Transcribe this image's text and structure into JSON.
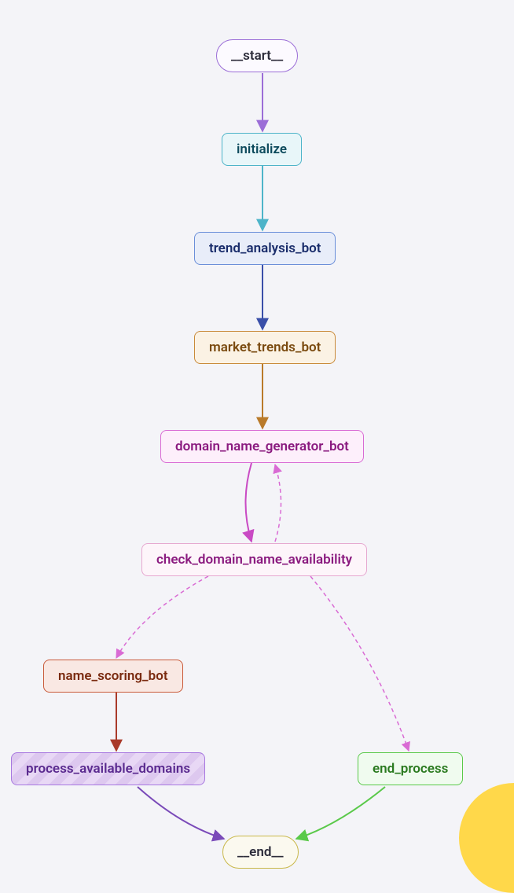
{
  "nodes": {
    "start": {
      "label": "__start__"
    },
    "initialize": {
      "label": "initialize"
    },
    "trend_analysis": {
      "label": "trend_analysis_bot"
    },
    "market_trends": {
      "label": "market_trends_bot"
    },
    "domain_gen": {
      "label": "domain_name_generator_bot"
    },
    "check_avail": {
      "label": "check_domain_name_availability"
    },
    "scoring": {
      "label": "name_scoring_bot"
    },
    "process_avail": {
      "label": "process_available_domains"
    },
    "end_process": {
      "label": "end_process"
    },
    "end": {
      "label": "__end__"
    }
  },
  "edges": [
    {
      "from": "start",
      "to": "initialize",
      "style": "solid",
      "color": "#9b6dd7"
    },
    {
      "from": "initialize",
      "to": "trend_analysis",
      "style": "solid",
      "color": "#4db4c9"
    },
    {
      "from": "trend_analysis",
      "to": "market_trends",
      "style": "solid",
      "color": "#3a4fa9"
    },
    {
      "from": "market_trends",
      "to": "domain_gen",
      "style": "solid",
      "color": "#b97a2a"
    },
    {
      "from": "domain_gen",
      "to": "check_avail",
      "style": "solid",
      "color": "#c94ac4",
      "bidirectional_dashed_back": true
    },
    {
      "from": "check_avail",
      "to": "scoring",
      "style": "dashed",
      "color": "#d96bd4"
    },
    {
      "from": "check_avail",
      "to": "end_process",
      "style": "dashed",
      "color": "#d96bd4"
    },
    {
      "from": "scoring",
      "to": "process_avail",
      "style": "solid",
      "color": "#a93a2a"
    },
    {
      "from": "process_avail",
      "to": "end",
      "style": "solid",
      "color": "#7a4ab9"
    },
    {
      "from": "end_process",
      "to": "end",
      "style": "solid",
      "color": "#5ac94a"
    }
  ],
  "colors": {
    "background": "#f4f4f8",
    "accent_yellow": "#ffd84a"
  }
}
